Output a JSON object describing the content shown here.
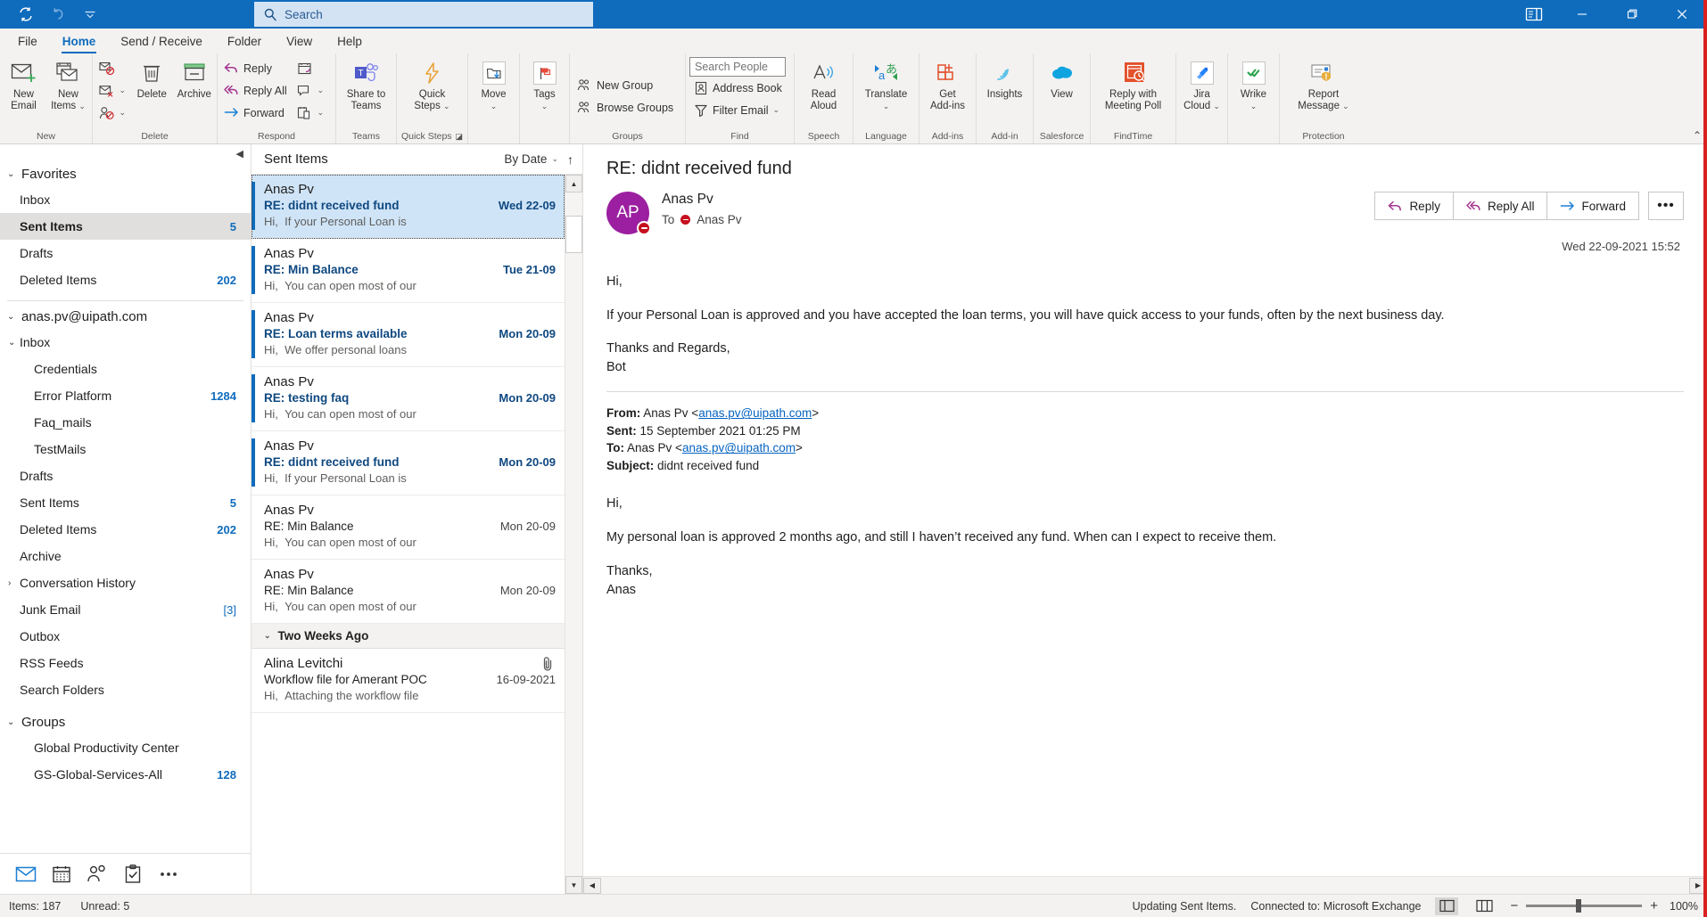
{
  "titlebar": {
    "quick_access": [
      {
        "name": "sync-icon",
        "label": "Send/Receive All Folders"
      },
      {
        "name": "undo-icon",
        "label": "Undo"
      },
      {
        "name": "customize-qat-icon",
        "label": "Customize Quick Access Toolbar"
      }
    ],
    "search_placeholder": "Search",
    "search_value": "",
    "window_buttons": [
      {
        "name": "account-manager-icon",
        "label": "Account"
      },
      {
        "name": "minimize-icon",
        "label": "Minimize"
      },
      {
        "name": "restore-icon",
        "label": "Restore Down"
      },
      {
        "name": "close-icon",
        "label": "Close"
      }
    ]
  },
  "menubar": {
    "tabs": [
      {
        "label": "File",
        "active": false
      },
      {
        "label": "Home",
        "active": true
      },
      {
        "label": "Send / Receive",
        "active": false
      },
      {
        "label": "Folder",
        "active": false
      },
      {
        "label": "View",
        "active": false
      },
      {
        "label": "Help",
        "active": false
      }
    ]
  },
  "ribbon": {
    "groups": [
      {
        "name": "new",
        "label": "New",
        "big": [
          {
            "label": "New\nEmail",
            "icon": "new-email-icon"
          },
          {
            "label": "New\nItems",
            "icon": "new-items-icon",
            "caret": true
          }
        ]
      },
      {
        "name": "delete",
        "label": "Delete",
        "small": [
          {
            "label": "",
            "icon": "ignore-icon"
          },
          {
            "label": "",
            "icon": "clean-up-icon",
            "caret": true
          },
          {
            "label": "",
            "icon": "junk-icon",
            "caret": true
          }
        ],
        "big": [
          {
            "label": "Delete",
            "icon": "delete-icon"
          },
          {
            "label": "Archive",
            "icon": "archive-icon"
          }
        ]
      },
      {
        "name": "respond",
        "label": "Respond",
        "small": [
          {
            "label": "Reply",
            "icon": "reply-icon"
          },
          {
            "label": "Reply All",
            "icon": "reply-all-icon"
          },
          {
            "label": "Forward",
            "icon": "forward-icon"
          }
        ],
        "small2": [
          {
            "label": "",
            "icon": "meeting-icon"
          },
          {
            "label": "",
            "icon": "im-icon",
            "caret": true
          },
          {
            "label": "",
            "icon": "more-respond-icon",
            "caret": true
          }
        ]
      },
      {
        "name": "teams",
        "label": "Teams",
        "big": [
          {
            "label": "Share to\nTeams",
            "icon": "teams-icon"
          }
        ]
      },
      {
        "name": "quick-steps",
        "label": "Quick Steps",
        "launcher": true,
        "big": [
          {
            "label": "Quick\nSteps",
            "icon": "quick-steps-icon",
            "caret": true
          }
        ]
      },
      {
        "name": "move",
        "label": "",
        "big": [
          {
            "label": "Move",
            "icon": "move-icon",
            "caret": true
          }
        ]
      },
      {
        "name": "tags",
        "label": "",
        "big": [
          {
            "label": "Tags",
            "icon": "tags-icon",
            "caret": true
          }
        ]
      },
      {
        "name": "groups",
        "label": "Groups",
        "small": [
          {
            "label": "New Group",
            "icon": "new-group-icon"
          },
          {
            "label": "Browse Groups",
            "icon": "browse-groups-icon"
          }
        ]
      },
      {
        "name": "find",
        "label": "Find",
        "search_people_placeholder": "Search People",
        "small": [
          {
            "label": "Address Book",
            "icon": "address-book-icon"
          },
          {
            "label": "Filter Email",
            "icon": "filter-email-icon",
            "caret": true
          }
        ]
      },
      {
        "name": "speech",
        "label": "Speech",
        "big": [
          {
            "label": "Read\nAloud",
            "icon": "read-aloud-icon"
          }
        ]
      },
      {
        "name": "language",
        "label": "Language",
        "big": [
          {
            "label": "Translate",
            "icon": "translate-icon",
            "caret": true
          }
        ]
      },
      {
        "name": "add-ins",
        "label": "Add-ins",
        "big": [
          {
            "label": "Get\nAdd-ins",
            "icon": "get-addins-icon"
          }
        ]
      },
      {
        "name": "add-in",
        "label": "Add-in",
        "big": [
          {
            "label": "Insights",
            "icon": "insights-icon"
          }
        ]
      },
      {
        "name": "salesforce",
        "label": "Salesforce",
        "big": [
          {
            "label": "View",
            "icon": "salesforce-cloud-icon"
          }
        ]
      },
      {
        "name": "findtime",
        "label": "FindTime",
        "big": [
          {
            "label": "Reply with\nMeeting Poll",
            "icon": "meeting-poll-icon"
          }
        ]
      },
      {
        "name": "jira",
        "label": "",
        "big": [
          {
            "label": "Jira\nCloud",
            "icon": "jira-icon",
            "caret": true
          }
        ]
      },
      {
        "name": "wrike",
        "label": "",
        "big": [
          {
            "label": "Wrike",
            "icon": "wrike-icon",
            "caret": true
          }
        ]
      },
      {
        "name": "protection",
        "label": "Protection",
        "big": [
          {
            "label": "Report\nMessage",
            "icon": "report-message-icon",
            "caret": true
          }
        ]
      }
    ],
    "collapse_label": "Collapse the Ribbon"
  },
  "folder_pane": {
    "collapse_label": "Collapse Folder Pane",
    "sections": [
      {
        "name": "favorites",
        "header": "Favorites",
        "expanded": true,
        "items": [
          {
            "label": "Inbox",
            "count": "",
            "selected": false,
            "indent": 1
          },
          {
            "label": "Sent Items",
            "count": "5",
            "selected": true,
            "indent": 1
          },
          {
            "label": "Drafts",
            "count": "",
            "selected": false,
            "indent": 1
          },
          {
            "label": "Deleted Items",
            "count": "202",
            "selected": false,
            "indent": 1
          }
        ]
      },
      {
        "name": "account",
        "header": "anas.pv@uipath.com",
        "expanded": true,
        "items": [
          {
            "label": "Inbox",
            "count": "",
            "selected": false,
            "indent": 1,
            "twisty": "expanded"
          },
          {
            "label": "Credentials",
            "count": "",
            "selected": false,
            "indent": 2
          },
          {
            "label": "Error Platform",
            "count": "1284",
            "selected": false,
            "indent": 2
          },
          {
            "label": "Faq_mails",
            "count": "",
            "selected": false,
            "indent": 2
          },
          {
            "label": "TestMails",
            "count": "",
            "selected": false,
            "indent": 2
          },
          {
            "label": "Drafts",
            "count": "",
            "selected": false,
            "indent": 1
          },
          {
            "label": "Sent Items",
            "count": "5",
            "selected": false,
            "indent": 1
          },
          {
            "label": "Deleted Items",
            "count": "202",
            "selected": false,
            "indent": 1
          },
          {
            "label": "Archive",
            "count": "",
            "selected": false,
            "indent": 1
          },
          {
            "label": "Conversation History",
            "count": "",
            "selected": false,
            "indent": 1,
            "twisty": "collapsed"
          },
          {
            "label": "Junk Email",
            "count": "[3]",
            "selected": false,
            "indent": 1
          },
          {
            "label": "Outbox",
            "count": "",
            "selected": false,
            "indent": 1
          },
          {
            "label": "RSS Feeds",
            "count": "",
            "selected": false,
            "indent": 1
          },
          {
            "label": "Search Folders",
            "count": "",
            "selected": false,
            "indent": 1
          }
        ]
      },
      {
        "name": "groups",
        "header": "Groups",
        "expanded": true,
        "items": [
          {
            "label": "Global Productivity Center",
            "count": "",
            "selected": false,
            "indent": 1
          },
          {
            "label": "GS-Global-Services-All",
            "count": "128",
            "selected": false,
            "indent": 1
          }
        ]
      }
    ],
    "nav_buttons": [
      {
        "name": "mail-nav-icon",
        "label": "Mail",
        "active": true
      },
      {
        "name": "calendar-nav-icon",
        "label": "Calendar",
        "active": false
      },
      {
        "name": "people-nav-icon",
        "label": "People",
        "active": false
      },
      {
        "name": "tasks-nav-icon",
        "label": "Tasks",
        "active": false
      },
      {
        "name": "more-nav-icon",
        "label": "More",
        "active": false
      }
    ]
  },
  "message_list": {
    "title": "Sent Items",
    "sort_label": "By Date",
    "sort_direction_icon": "arrow-up-icon",
    "messages": [
      {
        "sender": "Anas Pv",
        "subject": "RE: didnt received fund",
        "date": "Wed 22-09",
        "preview_prefix": "Hi,",
        "preview": "If your Personal Loan is",
        "selected": true,
        "unread": true,
        "attachment": false
      },
      {
        "sender": "Anas Pv",
        "subject": "RE: Min Balance",
        "date": "Tue 21-09",
        "preview_prefix": "Hi,",
        "preview": "You can open most of our",
        "selected": false,
        "unread": true,
        "attachment": false
      },
      {
        "sender": "Anas Pv",
        "subject": "RE: Loan terms available",
        "date": "Mon 20-09",
        "preview_prefix": "Hi,",
        "preview": "We offer personal loans",
        "selected": false,
        "unread": true,
        "attachment": false
      },
      {
        "sender": "Anas Pv",
        "subject": "RE: testing faq",
        "date": "Mon 20-09",
        "preview_prefix": "Hi,",
        "preview": "You can open most of our",
        "selected": false,
        "unread": true,
        "attachment": false
      },
      {
        "sender": "Anas Pv",
        "subject": "RE: didnt received fund",
        "date": "Mon 20-09",
        "preview_prefix": "Hi,",
        "preview": "If your Personal Loan is",
        "selected": false,
        "unread": true,
        "attachment": false
      },
      {
        "sender": "Anas Pv",
        "subject": "RE: Min Balance",
        "date": "Mon 20-09",
        "preview_prefix": "Hi,",
        "preview": "You can open most of our",
        "selected": false,
        "unread": false,
        "attachment": false
      },
      {
        "sender": "Anas Pv",
        "subject": "RE: Min Balance",
        "date": "Mon 20-09",
        "preview_prefix": "Hi,",
        "preview": "You can open most of our",
        "selected": false,
        "unread": false,
        "attachment": false
      }
    ],
    "day_group": "Two Weeks Ago",
    "messages_after_group": [
      {
        "sender": "Alina Levitchi",
        "subject": "Workflow file for Amerant POC",
        "date": "16-09-2021",
        "preview_prefix": "Hi,",
        "preview": "Attaching the workflow file",
        "selected": false,
        "unread": false,
        "attachment": true
      }
    ]
  },
  "reading_pane": {
    "subject": "RE: didnt received fund",
    "avatar_initials": "AP",
    "avatar_color": "#9b1fa0",
    "from_name": "Anas Pv",
    "to_label": "To",
    "to_name": "Anas Pv",
    "timestamp": "Wed 22-09-2021 15:52",
    "actions": [
      {
        "label": "Reply",
        "icon": "reply-icon"
      },
      {
        "label": "Reply All",
        "icon": "reply-all-icon"
      },
      {
        "label": "Forward",
        "icon": "forward-icon"
      }
    ],
    "more_label": "•••",
    "body": {
      "greeting": "Hi,",
      "paragraph1": "If your Personal Loan is approved and you have accepted the loan terms, you will have quick access to your funds, often by the next business day.",
      "signoff": "Thanks and Regards,",
      "signature": "Bot"
    },
    "quoted": {
      "from_label": "From:",
      "from_value": "Anas Pv <",
      "from_email": "anas.pv@uipath.com",
      "from_close": ">",
      "sent_label": "Sent:",
      "sent_value": "15 September 2021 01:25 PM",
      "to_label": "To:",
      "to_value": "Anas Pv <",
      "to_email": "anas.pv@uipath.com",
      "to_close": ">",
      "subject_label": "Subject:",
      "subject_value": "didnt received fund",
      "greeting": "Hi,",
      "paragraph1": "My personal loan is approved 2 months ago, and still I haven’t received any fund. When can I expect to receive them.",
      "signoff": "Thanks,",
      "signature": "Anas"
    }
  },
  "status_bar": {
    "items_count": "Items: 187",
    "unread_count": "Unread: 5",
    "sync_status": "Updating Sent Items.",
    "connection": "Connected to: Microsoft Exchange",
    "view_buttons": [
      {
        "name": "normal-view-icon",
        "active": true
      },
      {
        "name": "reading-view-icon",
        "active": false
      }
    ],
    "zoom_out": "−",
    "zoom_in": "+",
    "zoom_level": "100%"
  }
}
